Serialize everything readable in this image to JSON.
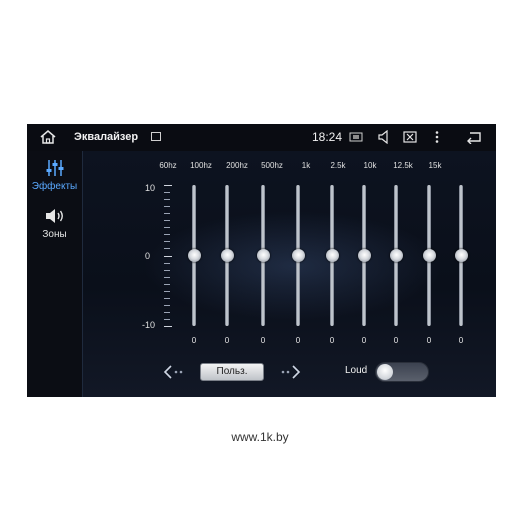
{
  "statusbar": {
    "title": "Эквалайзер",
    "time": "18:24",
    "icons": [
      "home-icon",
      "image-icon",
      "camera-icon",
      "volume-icon",
      "close-screen-icon",
      "more-icon",
      "back-icon"
    ]
  },
  "sidebar": {
    "items": [
      {
        "label": "Эффекты",
        "icon": "equalizer-icon",
        "active": true,
        "color": "#5aa9ff"
      },
      {
        "label": "Зоны",
        "icon": "speaker-icon",
        "active": false,
        "color": "#e6e6e6"
      }
    ]
  },
  "equalizer": {
    "scale_labels": [
      "10",
      "0",
      "-10"
    ],
    "bands": [
      {
        "freq": "60hz",
        "value": "0"
      },
      {
        "freq": "100hz",
        "value": "0"
      },
      {
        "freq": "200hz",
        "value": "0"
      },
      {
        "freq": "500hz",
        "value": "0"
      },
      {
        "freq": "1k",
        "value": "0"
      },
      {
        "freq": "2.5k",
        "value": "0"
      },
      {
        "freq": "10k",
        "value": "0"
      },
      {
        "freq": "12.5k",
        "value": "0"
      },
      {
        "freq": "15k",
        "value": "0"
      }
    ]
  },
  "controls": {
    "preset_label": "Польз.",
    "loud_label": "Loud",
    "loud_on": false
  },
  "watermark": "www.1k.by"
}
